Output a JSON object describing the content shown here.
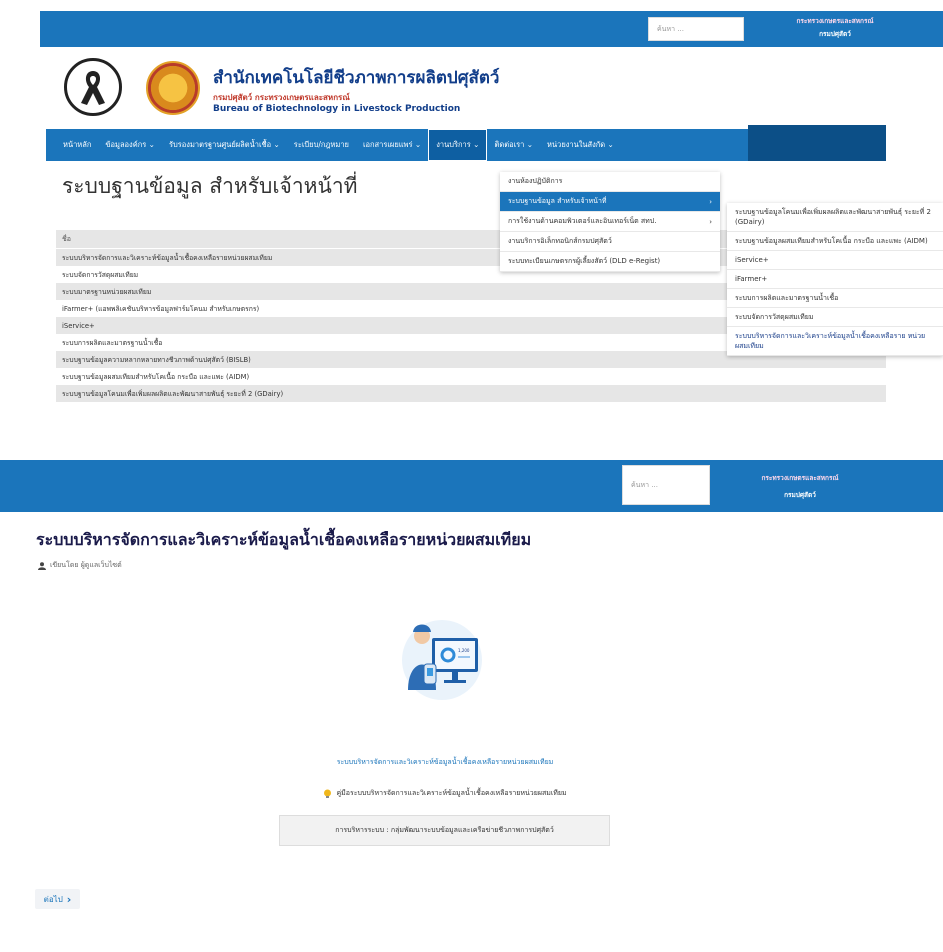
{
  "screen1": {
    "topbar": {
      "search_placeholder": "ค้นหา ...",
      "link_ministry": "กระทรวงเกษตรและสหกรณ์",
      "link_department": "กรมปศุสัตว์"
    },
    "brand": {
      "name_th": "สำนักเทคโนโลยีชีวภาพการผลิตปศุสัตว์",
      "org_th": "กรมปศุสัตว์ กระทรวงเกษตรและสหกรณ์",
      "name_en": "Bureau of Biotechnology in Livestock Production"
    },
    "nav": [
      {
        "label": "หน้าหลัก"
      },
      {
        "label": "ข้อมูลองค์กร ⌄"
      },
      {
        "label": "รับรองมาตรฐานศูนย์ผลิตน้ำเชื้อ ⌄"
      },
      {
        "label": "ระเบียบ/กฎหมาย"
      },
      {
        "label": "เอกสารเผยแพร่ ⌄"
      },
      {
        "label": "งานบริการ ⌄"
      },
      {
        "label": "ติดต่อเรา ⌄"
      },
      {
        "label": "หน่วยงานในสังกัด ⌄"
      }
    ],
    "page_title": "ระบบฐานข้อมูล สำหรับเจ้าหน้าที่",
    "list_header": "ชื่อ",
    "list_items": [
      "ระบบบริหารจัดการและวิเคราะห์ข้อมูลน้ำเชื้อคงเหลือรายหน่วยผสมเทียม",
      "ระบบจัดการวัสดุผสมเทียม",
      "ระบบมาตรฐานหน่วยผสมเทียม",
      "iFarmer+ (แอพพลิเคชันบริหารข้อมูลฟาร์มโคนม สำหรับเกษตรกร)",
      "iService+",
      "ระบบการผลิตและมาตรฐานน้ำเชื้อ",
      "ระบบฐานข้อมูลความหลากหลายทางชีวภาพด้านปศุสัตว์ (BISLB)",
      "ระบบฐานข้อมูลผสมเทียมสำหรับโคเนื้อ กระบือ และแพะ (AIDM)",
      "ระบบฐานข้อมูลโคนมเพื่อเพิ่มผลผลิตและพัฒนาสายพันธุ์ ระยะที่ 2 (GDairy)"
    ],
    "dropdown": [
      {
        "label": "งานห้องปฏิบัติการ",
        "arrow": ""
      },
      {
        "label": "ระบบฐานข้อมูล สำหรับเจ้าหน้าที่",
        "arrow": "›"
      },
      {
        "label": "การใช้งานด้านคอมพิวเตอร์และอินเทอร์เน็ต สทป.",
        "arrow": "›"
      },
      {
        "label": "งานบริการอิเล็กทอนิกส์กรมปศุสัตว์",
        "arrow": ""
      },
      {
        "label": "ระบบทะเบียนเกษตรกรผู้เลี้ยงสัตว์ (DLD e-Regist)",
        "arrow": ""
      }
    ],
    "submenu": [
      "ระบบฐานข้อมูลโคนมเพื่อเพิ่มผลผลิตและพัฒนาสายพันธุ์ ระยะที่ 2 (GDairy)",
      "ระบบฐานข้อมูลผสมเทียมสำหรับโคเนื้อ กระบือ และแพะ (AIDM)",
      "iService+",
      "iFarmer+",
      "ระบบการผลิตและมาตรฐานน้ำเชื้อ",
      "ระบบจัดการวัสดุผสมเทียม",
      "ระบบบริหารจัดการและวิเคราะห์ข้อมูลน้ำเชื้อคงเหลือราย หน่วยผสมเทียม"
    ]
  },
  "screen2": {
    "topbar": {
      "search_placeholder": "ค้นหา ...",
      "link_ministry": "กระทรวงเกษตรและสหกรณ์",
      "link_department": "กรมปศุสัตว์"
    },
    "post_title": "ระบบบริหารจัดการและวิเคราะห์ข้อมูลน้ำเชื้อคงเหลือรายหน่วยผสมเทียม",
    "author": "เขียนโดย ผู้ดูแลเว็บไซต์",
    "image_screen_value": "1,200",
    "content_link": "ระบบบริหารจัดการและวิเคราะห์ข้อมูลน้ำเชื้อคงเหลือรายหน่วยผสมเทียม",
    "manual_link": "คู่มือระบบบริหารจัดการและวิเคราะห์ข้อมูลน้ำเชื้อคงเหลือรายหน่วยผสมเทียม",
    "department_info": "การบริหารระบบ : กลุ่มพัฒนาระบบข้อมูลและเครือข่ายชีวภาพการปศุสัตว์",
    "next_label": "ต่อไป",
    "next_arrow": "›"
  },
  "colors": {
    "primary": "#1b75bb",
    "dark_blue": "#0c4f87",
    "title_blue": "#123e8a"
  }
}
